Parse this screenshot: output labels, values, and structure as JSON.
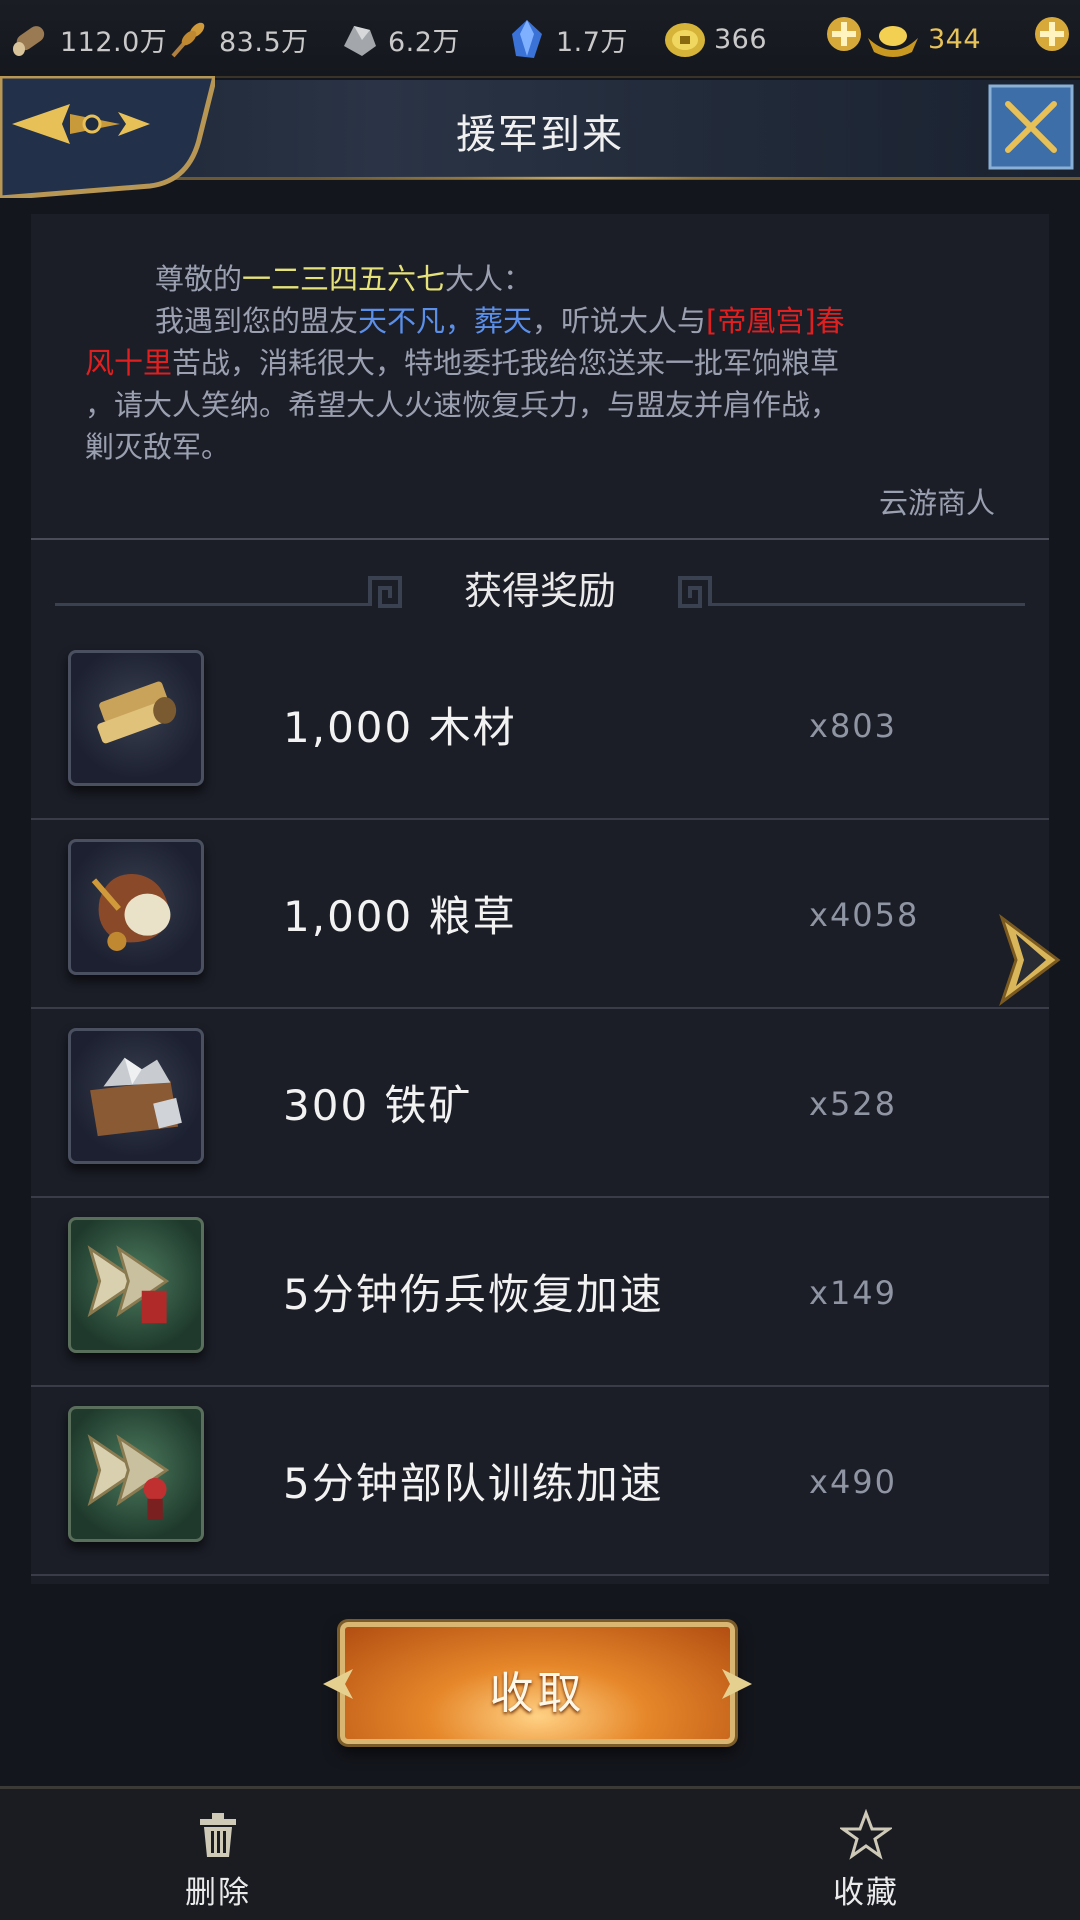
{
  "resources": [
    {
      "icon": "wood-log-icon",
      "value": "112.0万"
    },
    {
      "icon": "grain-icon",
      "value": "83.5万"
    },
    {
      "icon": "iron-ore-icon",
      "value": "6.2万"
    },
    {
      "icon": "blue-crystal-icon",
      "value": "1.7万"
    },
    {
      "icon": "copper-coin-icon",
      "value": "366"
    },
    {
      "icon": "gold-ingot-icon",
      "value": "344"
    }
  ],
  "header": {
    "title": "援军到来"
  },
  "letter": {
    "greeting_prefix": "尊敬的",
    "greeting_name": "一二三四五六七",
    "greeting_suffix": "大人：",
    "body_1": "我遇到您的盟友",
    "ally_names": "天不凡，葬天",
    "body_2": "，听说大人与",
    "enemy_line_1": "[帝凰宫]春",
    "enemy_line_2": "风十里",
    "body_3": "苦战，消耗很大，特地委托我给您送来一批军饷粮草",
    "body_4": "，请大人笑纳。希望大人火速恢复兵力，与盟友并肩作战，",
    "body_5": "剿灭敌军。",
    "signature": "云游商人"
  },
  "rewards_title": "获得奖励",
  "rewards": [
    {
      "icon": "wood-planks-icon",
      "name": "1,000  木材",
      "qty": "x803"
    },
    {
      "icon": "grain-sack-icon",
      "name": "1,000  粮草",
      "qty": "x4058"
    },
    {
      "icon": "iron-ore-crate-icon",
      "name": "300  铁矿",
      "qty": "x528"
    },
    {
      "icon": "heal-speedup-icon",
      "name": "5分钟伤兵恢复加速",
      "qty": "x149"
    },
    {
      "icon": "train-speedup-icon",
      "name": "5分钟部队训练加速",
      "qty": "x490"
    }
  ],
  "collect_label": "收取",
  "bottom": {
    "delete_label": "删除",
    "favorite_label": "收藏"
  }
}
